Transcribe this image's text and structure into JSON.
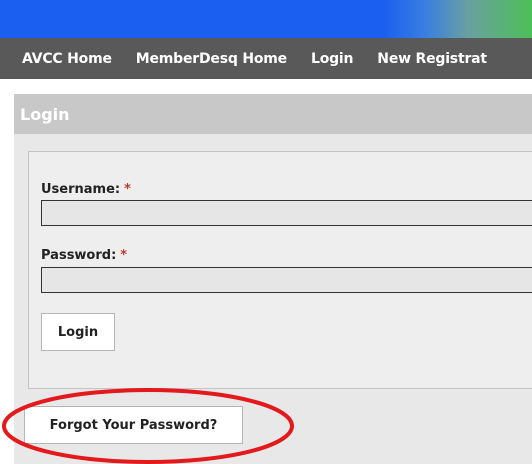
{
  "nav": {
    "items": [
      {
        "label": "AVCC Home"
      },
      {
        "label": "MemberDesq Home"
      },
      {
        "label": "Login"
      },
      {
        "label": "New Registrat"
      }
    ]
  },
  "login": {
    "title": "Login",
    "username_label": "Username:",
    "password_label": "Password:",
    "required_marker": "*",
    "username_value": "",
    "password_value": "",
    "submit_label": "Login",
    "forgot_label": "Forgot Your Password?"
  },
  "colors": {
    "navbar": "#595959",
    "banner": "#1a5ff0",
    "annotation": "#e3191c",
    "required": "#c0392b"
  }
}
